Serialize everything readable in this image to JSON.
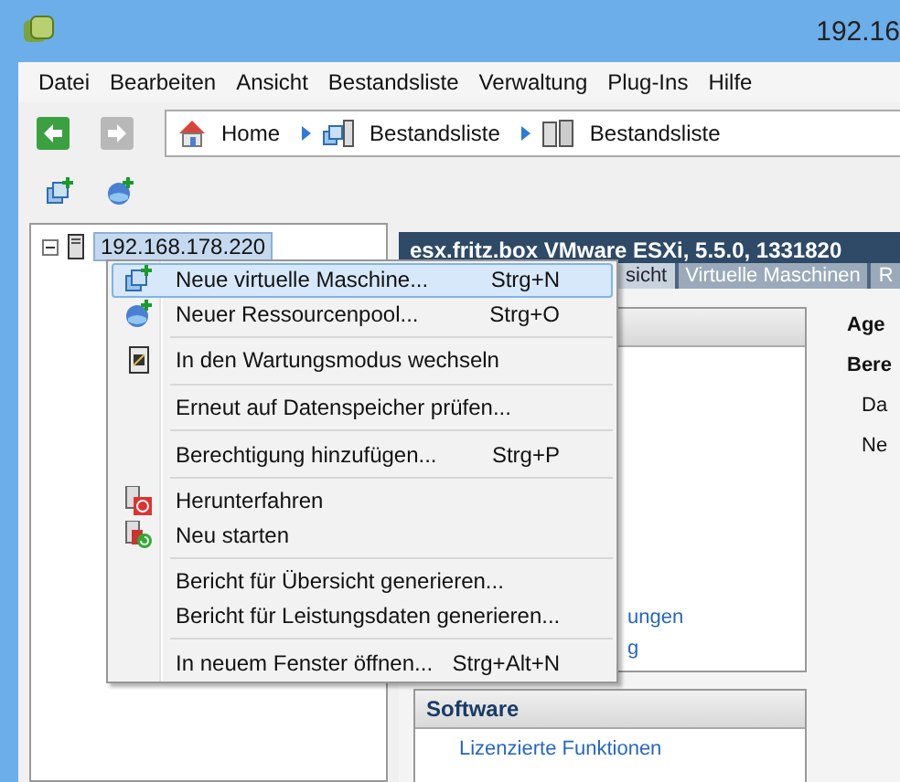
{
  "window": {
    "title": "192.16"
  },
  "menu_bar": [
    "Datei",
    "Bearbeiten",
    "Ansicht",
    "Bestandsliste",
    "Verwaltung",
    "Plug-Ins",
    "Hilfe"
  ],
  "breadcrumb": [
    {
      "label": "Home",
      "kind": "home"
    },
    {
      "label": "Bestandsliste",
      "kind": "inventory"
    },
    {
      "label": "Bestandsliste",
      "kind": "hosts"
    }
  ],
  "tree": [
    {
      "label": "192.168.178.220",
      "selected": true,
      "expanded": true
    }
  ],
  "host_panel": {
    "title": "esx.fritz.box VMware ESXi, 5.5.0, 1331820",
    "tabs": [
      {
        "label": "sicht",
        "selected": true
      },
      {
        "label": "Virtuelle Maschinen",
        "selected": false
      },
      {
        "label": "R",
        "selected": false
      }
    ],
    "links": [
      "ungen",
      "g"
    ],
    "side_labels": [
      {
        "label": "Age",
        "kind": "heading"
      },
      {
        "label": "Bere",
        "kind": "heading"
      },
      {
        "label": "Da",
        "kind": "item"
      },
      {
        "label": "Ne",
        "kind": "item"
      }
    ],
    "software": {
      "title": "Software",
      "links": [
        "Lizenzierte Funktionen"
      ]
    }
  },
  "context_menu": [
    {
      "kind": "item",
      "label": "Neue virtuelle Maschine...",
      "shortcut": "Strg+N",
      "selected": true
    },
    {
      "kind": "item",
      "label": "Neuer Ressourcenpool...",
      "shortcut": "Strg+O",
      "selected": false
    },
    {
      "kind": "separator"
    },
    {
      "kind": "item",
      "label": "In den Wartungsmodus wechseln",
      "selected": false
    },
    {
      "kind": "separator"
    },
    {
      "kind": "item",
      "label": "Erneut auf Datenspeicher prüfen...",
      "selected": false
    },
    {
      "kind": "separator"
    },
    {
      "kind": "item",
      "label": "Berechtigung hinzufügen...",
      "shortcut": "Strg+P",
      "selected": false
    },
    {
      "kind": "separator"
    },
    {
      "kind": "item",
      "label": "Herunterfahren",
      "selected": false
    },
    {
      "kind": "item",
      "label": "Neu starten",
      "selected": false
    },
    {
      "kind": "separator"
    },
    {
      "kind": "item",
      "label": "Bericht für Übersicht generieren...",
      "selected": false
    },
    {
      "kind": "item",
      "label": "Bericht für Leistungsdaten generieren...",
      "selected": false
    },
    {
      "kind": "separator"
    },
    {
      "kind": "item",
      "label": "In neuem Fenster öffnen...",
      "shortcut": "Strg+Alt+N",
      "selected": false
    }
  ]
}
